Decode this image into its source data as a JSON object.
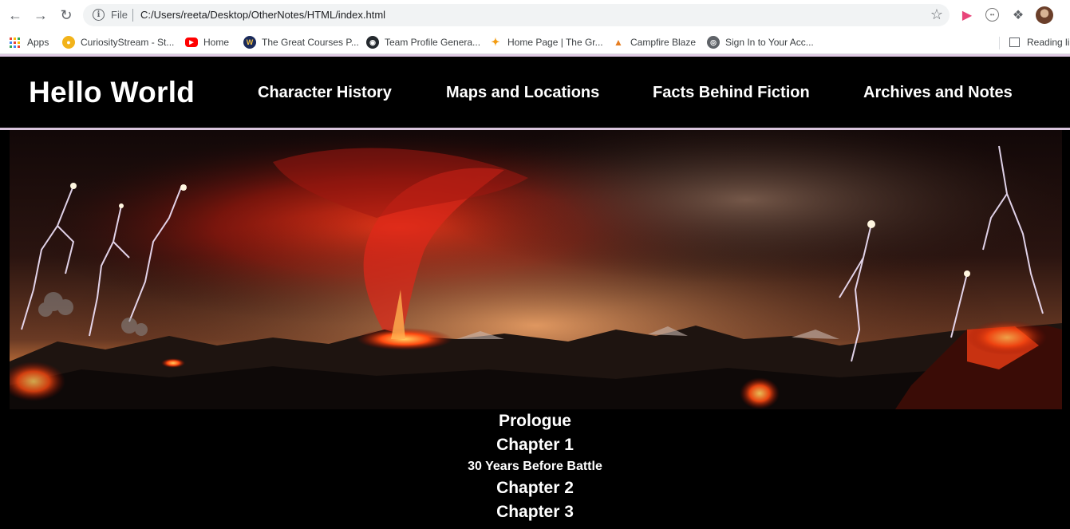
{
  "browser": {
    "scheme_label": "File",
    "url": "C:/Users/reeta/Desktop/OtherNotes/HTML/index.html",
    "bookmarks": [
      {
        "label": "Apps"
      },
      {
        "label": "CuriosityStream - St..."
      },
      {
        "label": "Home"
      },
      {
        "label": "The Great Courses P..."
      },
      {
        "label": "Team Profile Genera..."
      },
      {
        "label": "Home Page | The Gr..."
      },
      {
        "label": "Campfire Blaze"
      },
      {
        "label": "Sign In to Your Acc..."
      }
    ],
    "reading_list_label": "Reading li"
  },
  "site": {
    "title": "Hello World",
    "nav": [
      {
        "label": "Character History"
      },
      {
        "label": "Maps and Locations"
      },
      {
        "label": "Facts Behind Fiction"
      },
      {
        "label": "Archives and Notes"
      }
    ]
  },
  "chapters": [
    {
      "label": "Prologue"
    },
    {
      "label": "Chapter 1"
    },
    {
      "label": "30 Years Before Battle"
    },
    {
      "label": "Chapter 2"
    },
    {
      "label": "Chapter 3"
    }
  ],
  "colors": {
    "page_background": "#000000",
    "header_rule": "#d9c4dc",
    "text": "#ffffff"
  }
}
